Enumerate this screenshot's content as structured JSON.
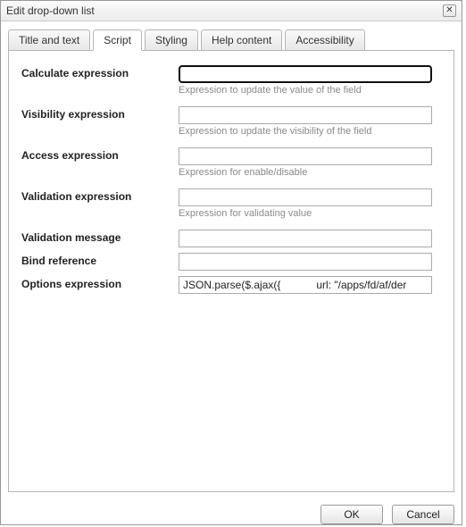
{
  "window": {
    "title": "Edit drop-down list"
  },
  "tabs": {
    "title_and_text": "Title and text",
    "script": "Script",
    "styling": "Styling",
    "help_content": "Help content",
    "accessibility": "Accessibility"
  },
  "form": {
    "calculate": {
      "label": "Calculate expression",
      "value": "",
      "hint": "Expression to update the value of the field"
    },
    "visibility": {
      "label": "Visibility expression",
      "value": "",
      "hint": "Expression to update the visibility of the field"
    },
    "access": {
      "label": "Access expression",
      "value": "",
      "hint": "Expression for enable/disable"
    },
    "validation": {
      "label": "Validation expression",
      "value": "",
      "hint": "Expression for validating value"
    },
    "validation_message": {
      "label": "Validation message",
      "value": ""
    },
    "bind_reference": {
      "label": "Bind reference",
      "value": ""
    },
    "options": {
      "label": "Options expression",
      "value": "JSON.parse($.ajax({            url: \"/apps/fd/af/der"
    }
  },
  "buttons": {
    "ok": "OK",
    "cancel": "Cancel"
  }
}
